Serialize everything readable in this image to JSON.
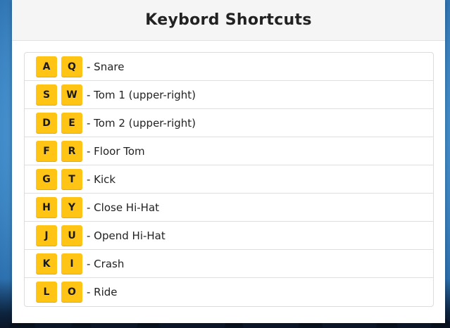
{
  "title": "Keybord Shortcuts",
  "colors": {
    "key_bg": "#ffc414",
    "header_bg": "#f5f5f5"
  },
  "shortcuts": [
    {
      "keys": [
        "A",
        "Q"
      ],
      "label": "- Snare"
    },
    {
      "keys": [
        "S",
        "W"
      ],
      "label": "- Tom 1 (upper-right)"
    },
    {
      "keys": [
        "D",
        "E"
      ],
      "label": "- Tom 2 (upper-right)"
    },
    {
      "keys": [
        "F",
        "R"
      ],
      "label": "- Floor Tom"
    },
    {
      "keys": [
        "G",
        "T"
      ],
      "label": "- Kick"
    },
    {
      "keys": [
        "H",
        "Y"
      ],
      "label": "- Close Hi-Hat"
    },
    {
      "keys": [
        "J",
        "U"
      ],
      "label": "- Opend Hi-Hat"
    },
    {
      "keys": [
        "K",
        "I"
      ],
      "label": "- Crash"
    },
    {
      "keys": [
        "L",
        "O"
      ],
      "label": "- Ride"
    }
  ]
}
